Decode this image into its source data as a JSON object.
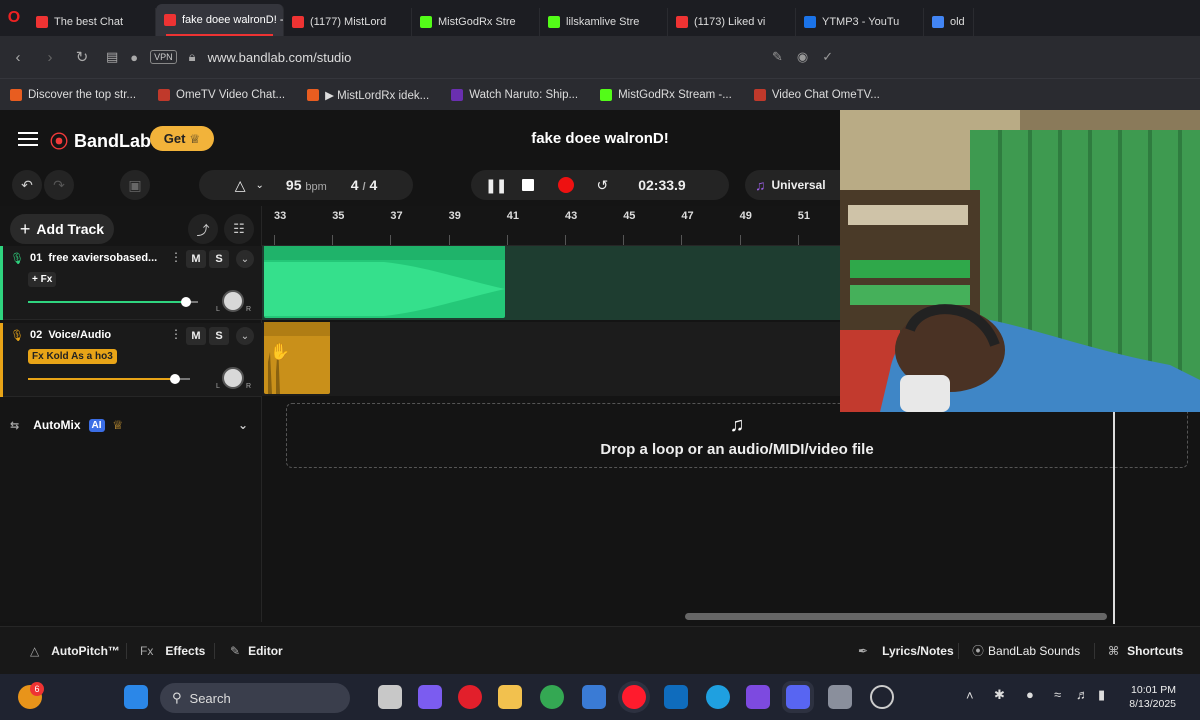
{
  "browser": {
    "tabs": [
      {
        "label": "The best Chat",
        "color": "#e33"
      },
      {
        "label": "fake doee walronD! - Stu",
        "color": "#e33",
        "active": true
      },
      {
        "label": "(1177) MistLord",
        "color": "#e33"
      },
      {
        "label": "MistGodRx Stre",
        "color": "#53fc18"
      },
      {
        "label": "lilskamlive Stre",
        "color": "#53fc18"
      },
      {
        "label": "(1173) Liked vi",
        "color": "#e33"
      },
      {
        "label": "YTMP3 - YouTu",
        "color": "#1b73e8"
      },
      {
        "label": "old",
        "color": "#4285f4"
      }
    ],
    "vpn_label": "VPN",
    "url": "www.bandlab.com/studio",
    "bookmarks": [
      {
        "label": "Discover the top str...",
        "color": "#e85d20"
      },
      {
        "label": "OmeTV Video Chat...",
        "color": "#c0392b"
      },
      {
        "label": "▶ MistLordRx idek...",
        "color": "#e85d20"
      },
      {
        "label": "Watch Naruto: Ship...",
        "color": "#6a2fb0"
      },
      {
        "label": "MistGodRx Stream -...",
        "color": "#53fc18"
      },
      {
        "label": "Video Chat OmeTV...",
        "color": "#c0392b"
      }
    ]
  },
  "app": {
    "brand": "BandLab",
    "get_label": "Get",
    "project_title": "fake doee walronD!",
    "bpm_value": "95",
    "bpm_unit": "bpm",
    "time_sig_num": "4",
    "time_sig_sep": "/",
    "time_sig_den": "4",
    "time_display": "02:33.9",
    "scale_label": "Universal",
    "add_track_label": "Add Track",
    "ruler_ticks": [
      "33",
      "35",
      "37",
      "39",
      "41",
      "43",
      "45",
      "47",
      "49",
      "51"
    ],
    "tracks": [
      {
        "number": "01",
        "name": "free xaviersobased...",
        "fx": "+ Fx",
        "color": "#2fd47f",
        "volume": 0.93
      },
      {
        "number": "02",
        "name": "Voice/Audio",
        "fx": "Fx Kold As a ho3",
        "color": "#e8a417",
        "volume": 0.91
      }
    ],
    "mute_label": "M",
    "solo_label": "S",
    "pan_left": "L",
    "pan_right": "R",
    "automix_label": "AutoMix",
    "ai_badge": "AI",
    "drop_label": "Drop a loop or an audio/MIDI/video file",
    "bottom": {
      "autopitch": "AutoPitch™",
      "effects_prefix": "Fx",
      "effects": "Effects",
      "editor": "Editor",
      "lyrics": "Lyrics/Notes",
      "sounds": "BandLab Sounds",
      "shortcuts": "Shortcuts"
    }
  },
  "taskbar": {
    "notification_count": "6",
    "search_placeholder": "Search",
    "time": "10:01 PM",
    "date": "8/13/2025"
  },
  "colors": {
    "accent_red": "#f03a3a",
    "get_yellow": "#f2b33a",
    "track1_green": "#2fd47f",
    "track2_gold": "#e8a417"
  }
}
